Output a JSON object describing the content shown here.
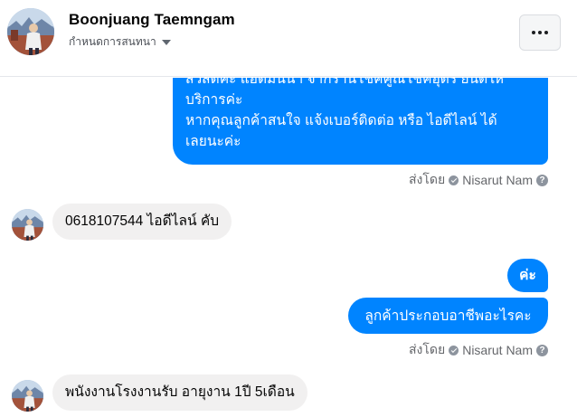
{
  "header": {
    "name": "Boonjuang Taemngam",
    "subtitle": "กำหนดการสนทนา",
    "more_icon": "more-horizontal-icon"
  },
  "messages": [
    {
      "direction": "outgoing",
      "lines": [
        "สวัสดีค่ะ แอดมินนา จากร้านโชคคูณโชคอุดร ยินดีให้",
        "บริการค่ะ",
        "หากคุณลูกค้าสนใจ แจ้งเบอร์ติดต่อ หรือ ไอดีไลน์ ได้",
        "เลยนะค่ะ"
      ],
      "sent_by_prefix": "ส่งโดย",
      "sent_by_name": "Nisarut Nam",
      "help_icon": "?"
    },
    {
      "direction": "incoming",
      "text": "0618107544 ไอดีไลน์ คับ"
    },
    {
      "direction": "outgoing",
      "text": "ค่ะ"
    },
    {
      "direction": "outgoing",
      "text": "ลูกค้าประกอบอาชีพอะไรคะ",
      "sent_by_prefix": "ส่งโดย",
      "sent_by_name": "Nisarut Nam",
      "help_icon": "?"
    },
    {
      "direction": "incoming",
      "text": "พนังงานโรงงานรับ อายุงาน 1ปี 5เดือน"
    }
  ],
  "colors": {
    "outgoing_bubble": "#0084ff",
    "incoming_bubble": "#f1f0f0",
    "meta_text": "#65676b"
  }
}
